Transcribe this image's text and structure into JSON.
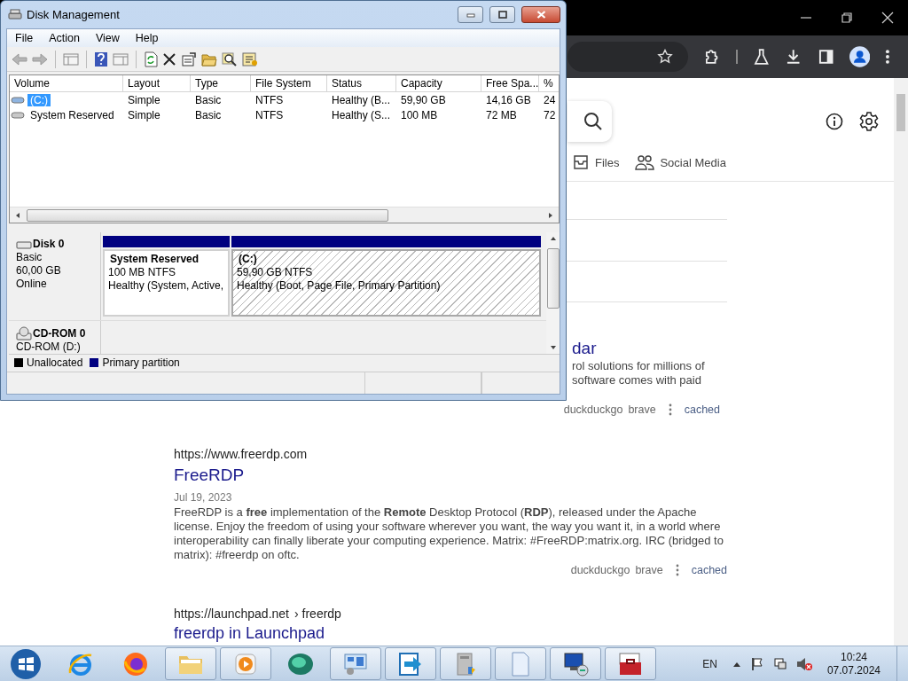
{
  "browser": {
    "tabs": [
      {
        "label": "Files",
        "kind": "files"
      },
      {
        "label": "Social Media",
        "kind": "people"
      }
    ],
    "results": [
      {
        "title": "dar",
        "snippet_lines": [
          "rol solutions for millions of",
          "software comes with paid"
        ],
        "actions": [
          "duckduckgo",
          "brave",
          "cached"
        ]
      },
      {
        "url": "https://www.freerdp.com",
        "title": "FreeRDP",
        "date": "Jul 19, 2023",
        "snippet": "FreeRDP is a **free** implementation of the **Remote** Desktop Protocol (**RDP**), released under the Apache license. Enjoy the freedom of using your software wherever you want, the way you want it, in a world where interoperability can finally liberate your computing experience. Matrix: #FreeRDP:matrix.org. IRC (bridged to matrix): #freerdp on oftc.",
        "actions": [
          "duckduckgo",
          "brave",
          "cached"
        ]
      },
      {
        "url": "https://launchpad.net",
        "path": "› freerdp",
        "title": "freerdp in Launchpad"
      }
    ]
  },
  "disk_management": {
    "title": "Disk Management",
    "menu": [
      "File",
      "Action",
      "View",
      "Help"
    ],
    "columns": [
      "Volume",
      "Layout",
      "Type",
      "File System",
      "Status",
      "Capacity",
      "Free Spa...",
      "%"
    ],
    "rows": [
      {
        "cells": [
          "(C:)",
          "Simple",
          "Basic",
          "NTFS",
          "Healthy (B...",
          "59,90 GB",
          "14,16 GB",
          "24"
        ],
        "selected": true
      },
      {
        "cells": [
          "System Reserved",
          "Simple",
          "Basic",
          "NTFS",
          "Healthy (S...",
          "100 MB",
          "72 MB",
          "72"
        ],
        "selected": false
      }
    ],
    "disks": [
      {
        "kind": "disk",
        "name": "Disk 0",
        "details": [
          "Basic",
          "60,00 GB",
          "Online"
        ],
        "partitions": [
          {
            "name": "System Reserved",
            "size": "100 MB NTFS",
            "status": "Healthy (System, Active,",
            "selected": false
          },
          {
            "name": "(C:)",
            "size": "59,90 GB NTFS",
            "status": "Healthy (Boot, Page File, Primary Partition)",
            "selected": true
          }
        ]
      },
      {
        "kind": "cdrom",
        "name": "CD-ROM 0",
        "details": [
          "CD-ROM (D:)"
        ]
      }
    ],
    "legend": [
      {
        "label": "Unallocated",
        "color": "#000000"
      },
      {
        "label": "Primary partition",
        "color": "#000080"
      }
    ]
  },
  "taskbar": {
    "apps": [
      {
        "kind": "start",
        "running": false
      },
      {
        "kind": "ie",
        "running": false
      },
      {
        "kind": "firefox",
        "running": false
      },
      {
        "kind": "explorer",
        "running": true
      },
      {
        "kind": "media",
        "running": true
      },
      {
        "kind": "orb",
        "running": false
      },
      {
        "kind": "control",
        "running": true
      },
      {
        "kind": "remote",
        "running": true
      },
      {
        "kind": "archive",
        "running": true
      },
      {
        "kind": "document",
        "running": true
      },
      {
        "kind": "network",
        "running": true
      },
      {
        "kind": "toolbox",
        "running": true
      }
    ],
    "language": "EN",
    "time": "10:24",
    "date": "07.07.2024"
  }
}
